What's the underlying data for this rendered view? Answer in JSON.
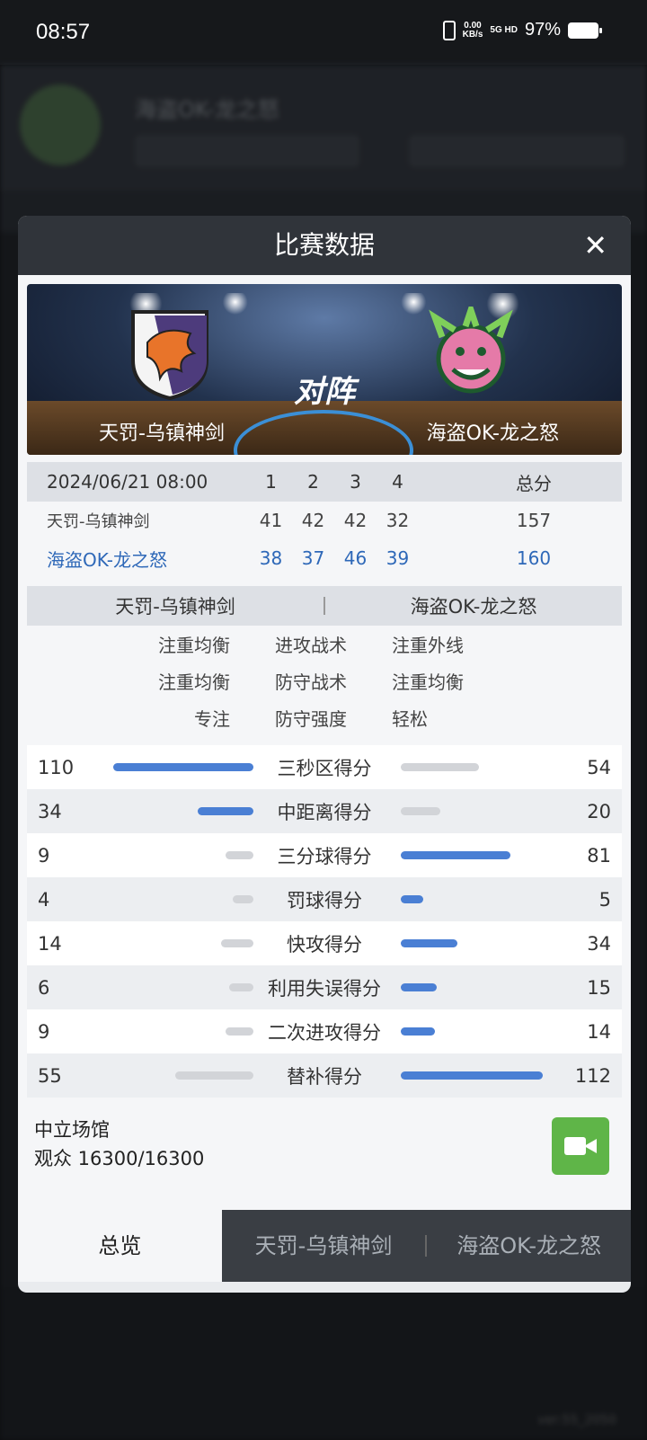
{
  "status_bar": {
    "time": "08:57",
    "net_speed": "0.00",
    "net_unit": "KB/s",
    "signal": "5G HD",
    "battery": "97%"
  },
  "background": {
    "title": "海盗OK-龙之怒",
    "version": "ver:55_2050"
  },
  "modal": {
    "title": "比赛数据",
    "banner": {
      "vs": "对阵",
      "team1": "天罚-乌镇神剑",
      "team2": "海盗OK-龙之怒"
    },
    "score_header": {
      "datetime": "2024/06/21 08:00",
      "q1": "1",
      "q2": "2",
      "q3": "3",
      "q4": "4",
      "total": "总分"
    },
    "score_rows": [
      {
        "team": "天罚-乌镇神剑",
        "q1": "41",
        "q2": "42",
        "q3": "42",
        "q4": "32",
        "total": "157"
      },
      {
        "team": "海盗OK-龙之怒",
        "q1": "38",
        "q2": "37",
        "q3": "46",
        "q4": "39",
        "total": "160"
      }
    ],
    "tactics_header": {
      "left": "天罚-乌镇神剑",
      "right": "海盗OK-龙之怒"
    },
    "tactics": [
      {
        "left": "注重均衡",
        "label": "进攻战术",
        "right": "注重外线"
      },
      {
        "left": "注重均衡",
        "label": "防守战术",
        "right": "注重均衡"
      },
      {
        "left": "专注",
        "label": "防守强度",
        "right": "轻松"
      }
    ],
    "stats": [
      {
        "label": "三秒区得分",
        "left": "110",
        "right": "54",
        "lfrac": 1.0,
        "rfrac": 0.55,
        "lc": "#4a7fd4",
        "rc": "#d2d4d8"
      },
      {
        "label": "中距离得分",
        "left": "34",
        "right": "20",
        "lfrac": 0.4,
        "rfrac": 0.28,
        "lc": "#4a7fd4",
        "rc": "#d2d4d8"
      },
      {
        "label": "三分球得分",
        "left": "9",
        "right": "81",
        "lfrac": 0.2,
        "rfrac": 0.77,
        "lc": "#d2d4d8",
        "rc": "#4a7fd4"
      },
      {
        "label": "罚球得分",
        "left": "4",
        "right": "5",
        "lfrac": 0.15,
        "rfrac": 0.16,
        "lc": "#d2d4d8",
        "rc": "#4a7fd4"
      },
      {
        "label": "快攻得分",
        "left": "14",
        "right": "34",
        "lfrac": 0.23,
        "rfrac": 0.4,
        "lc": "#d2d4d8",
        "rc": "#4a7fd4"
      },
      {
        "label": "利用失误得分",
        "left": "6",
        "right": "15",
        "lfrac": 0.17,
        "rfrac": 0.25,
        "lc": "#d2d4d8",
        "rc": "#4a7fd4"
      },
      {
        "label": "二次进攻得分",
        "left": "9",
        "right": "14",
        "lfrac": 0.2,
        "rfrac": 0.24,
        "lc": "#d2d4d8",
        "rc": "#4a7fd4"
      },
      {
        "label": "替补得分",
        "left": "55",
        "right": "112",
        "lfrac": 0.56,
        "rfrac": 1.0,
        "lc": "#d2d4d8",
        "rc": "#4a7fd4"
      }
    ],
    "venue": {
      "name": "中立场馆",
      "attendance": "观众 16300/16300"
    },
    "tabs": [
      "总览",
      "天罚-乌镇神剑",
      "海盗OK-龙之怒"
    ]
  }
}
